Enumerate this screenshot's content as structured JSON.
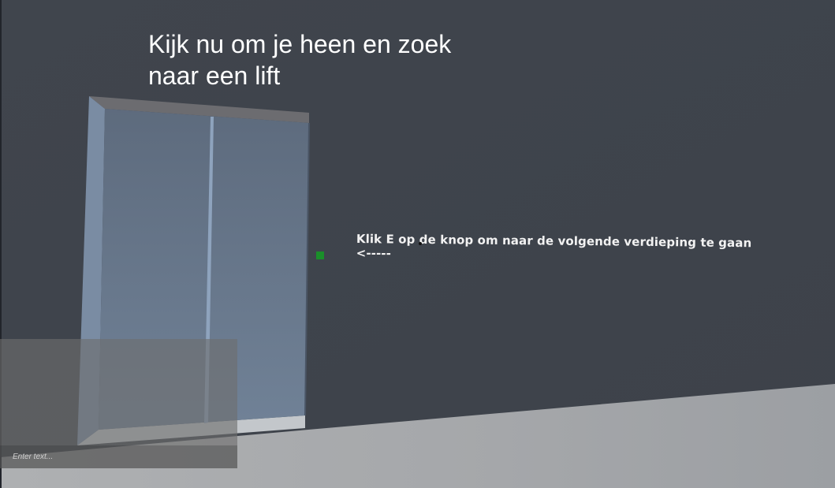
{
  "hud": {
    "title_line1": "Kijk nu om je heen en zoek",
    "title_line2": "naar een lift"
  },
  "hint": {
    "line1": "Klik E op de knop om naar de volgende verdieping te gaan",
    "line2": "<-----"
  },
  "console": {
    "placeholder": "Enter text...",
    "value": ""
  },
  "colors": {
    "wall": "#3e434b",
    "floor": "#a9abad",
    "elevator_glass": "#6d7d92",
    "button_marker": "#1a8f2a"
  }
}
